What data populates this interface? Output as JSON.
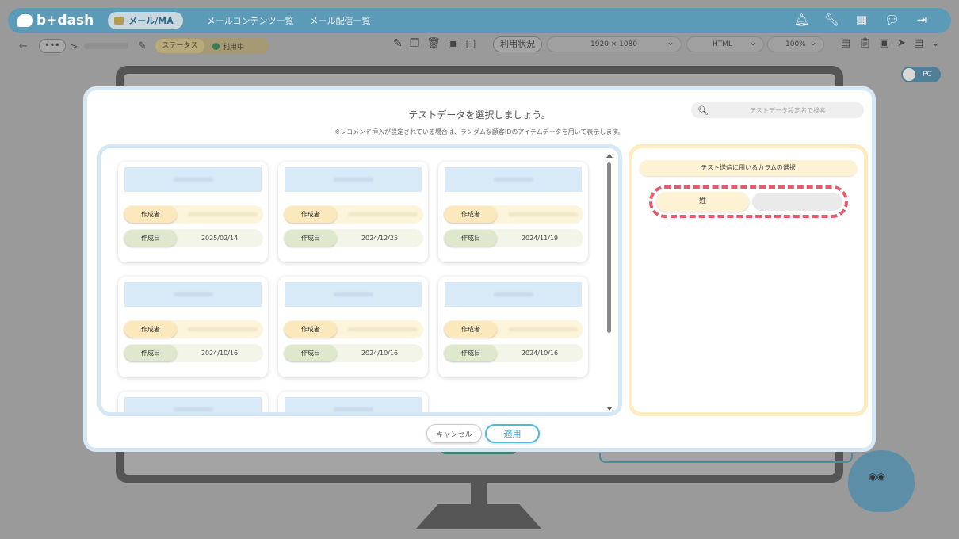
{
  "app": {
    "logo_text": "b+dash",
    "mail_pill": "メール/MA",
    "nav": [
      "メールコンテンツ一覧",
      "メール配信一覧"
    ]
  },
  "subbar": {
    "back": "←",
    "dots": "•••",
    "sep": ">",
    "status_label": "ステータス",
    "status_value": "利用中",
    "usage_button": "利用状況",
    "resolution": "1920 × 1080",
    "format": "HTML",
    "zoom": "100%"
  },
  "toggle": {
    "label": "PC"
  },
  "modal": {
    "title": "テストデータを選択しましょう。",
    "note": "※レコメンド挿入が設定されている場合は、ランダムな顧客IDのアイテムデータを用いて表示します。",
    "search_placeholder": "テストデータ設定名で検索",
    "author_label": "作成者",
    "date_label": "作成日",
    "cards": [
      {
        "date": "2025/02/14"
      },
      {
        "date": "2024/12/25"
      },
      {
        "date": "2024/11/19"
      },
      {
        "date": "2024/10/16"
      },
      {
        "date": "2024/10/16"
      },
      {
        "date": "2024/10/16"
      },
      {
        "date": ""
      },
      {
        "date": ""
      }
    ],
    "column_select_title": "テスト送信に用いるカラムの選択",
    "column_selected": "姓",
    "cancel_label": "キャンセル",
    "apply_label": "適用"
  },
  "colors": {
    "accent_blue": "#4fb8e0",
    "highlight_red": "#e55b6a",
    "panel_blue": "#d6e8f5",
    "panel_yellow": "#fdecc2"
  }
}
